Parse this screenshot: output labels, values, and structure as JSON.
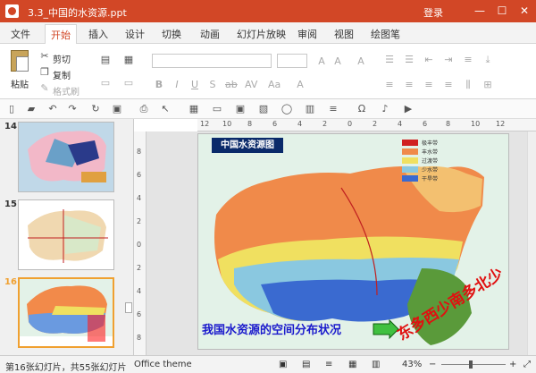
{
  "window": {
    "title": "3.3_中国的水资源.ppt",
    "login": "登录",
    "min": "—",
    "max": "☐",
    "close": "✕"
  },
  "tabs": [
    "文件",
    "开始",
    "插入",
    "设计",
    "切换",
    "动画",
    "幻灯片放映",
    "审阅",
    "视图",
    "绘图笔"
  ],
  "clipboard": {
    "paste": "粘贴",
    "cut": "剪切",
    "copy": "复制",
    "format": "格式刷"
  },
  "slides": [
    {
      "num": "14"
    },
    {
      "num": "15"
    },
    {
      "num": "16"
    }
  ],
  "ruler_top": [
    "12",
    "10",
    "8",
    "6",
    "4",
    "2",
    "0",
    "2",
    "4",
    "6",
    "8",
    "10",
    "12"
  ],
  "ruler_left": [
    "8",
    "6",
    "4",
    "2",
    "0",
    "2",
    "4",
    "6",
    "8"
  ],
  "slide": {
    "title": "中国水资源图",
    "caption": "我国水资源的空间分布状况",
    "handwriting": "东多西少南多北少",
    "legend": [
      "极丰带",
      "丰水带",
      "过渡带",
      "少水带",
      "干旱带"
    ]
  },
  "status": {
    "slide_info": "第16张幻灯片，共55张幻灯片",
    "theme": "Office theme",
    "zoom": "43%"
  },
  "colors": {
    "accent": "#d24726",
    "selected_border": "#f0a030"
  }
}
